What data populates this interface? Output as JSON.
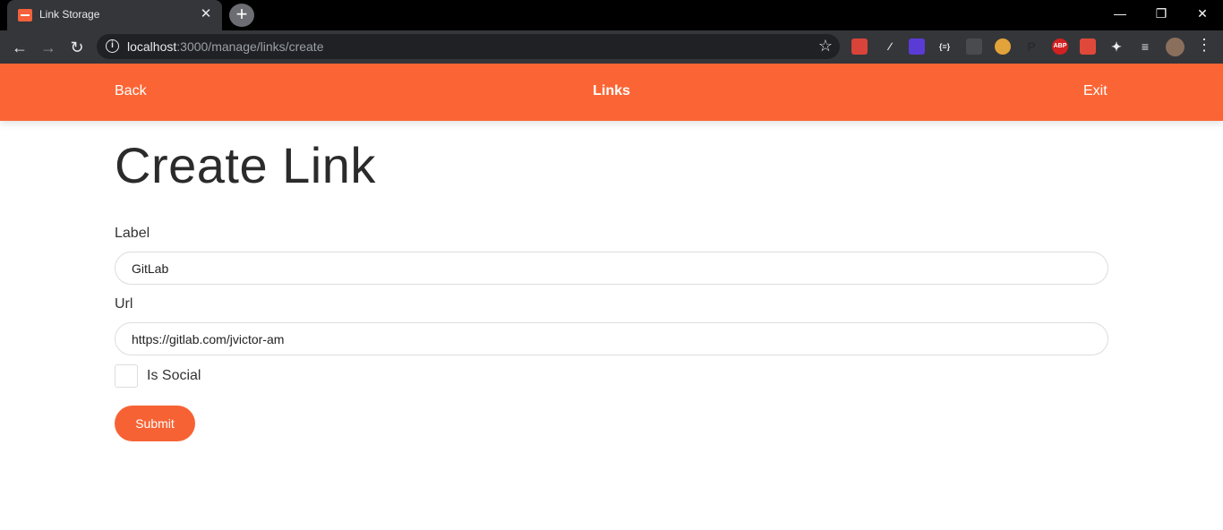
{
  "browser": {
    "tab_title": "Link Storage",
    "tab_close": "✕",
    "new_tab": "+",
    "url_host": "localhost",
    "url_rest": ":3000/manage/links/create",
    "window_controls": {
      "minimize": "—",
      "restore": "❐",
      "close": "✕"
    },
    "extensions": [
      "ext-1",
      "ext-2",
      "ext-3",
      "{≡}",
      "ext-5",
      "ext-6",
      "ext-7",
      "ABP",
      "ext-9",
      "puzzle-icon",
      "media-icon"
    ]
  },
  "header": {
    "back_label": "Back",
    "title": "Links",
    "exit_label": "Exit",
    "color": "#fb6535"
  },
  "form": {
    "title": "Create Link",
    "label_field_label": "Label",
    "label_value": "GitLab",
    "url_field_label": "Url",
    "url_value": "https://gitlab.com/jvictor-am",
    "is_social_label": "Is Social",
    "is_social_checked": false,
    "submit_label": "Submit"
  }
}
